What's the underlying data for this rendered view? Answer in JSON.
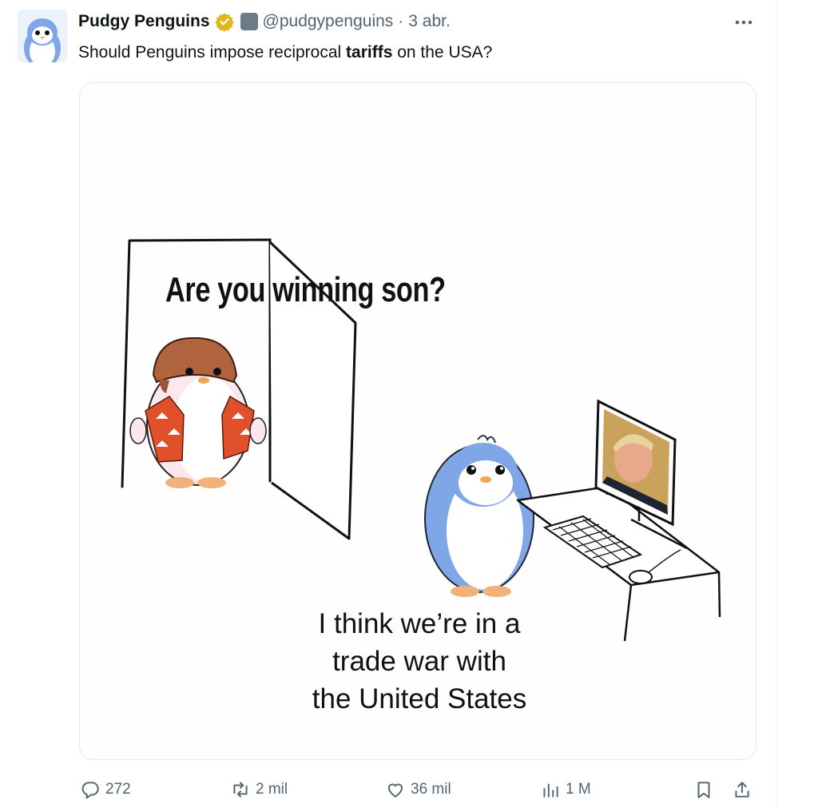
{
  "tweet": {
    "author": {
      "display_name": "Pudgy Penguins",
      "handle": "@pudgypenguins",
      "separator": "·",
      "time": "3 abr."
    },
    "text_before": "Should Penguins impose reciprocal ",
    "text_bold": "tariffs",
    "text_after": " on the USA?",
    "media": {
      "top_caption": "Are you winning son?",
      "bottom_caption_lines": [
        "I think we’re in a",
        "trade war with",
        "the United States"
      ]
    }
  },
  "actions": {
    "replies": "272",
    "reposts": "2 mil",
    "likes": "36 mil",
    "views": "1 M"
  },
  "icons": {
    "avatar": "penguin-avatar",
    "verified": "verified-badge-icon",
    "more": "more-options-icon",
    "reply": "reply-icon",
    "repost": "repost-icon",
    "like": "heart-icon",
    "views": "views-chart-icon",
    "bookmark": "bookmark-icon",
    "share": "share-icon"
  },
  "colors": {
    "text_secondary": "#536471",
    "verified_gold": "#e2b719",
    "border": "#e1e8ed"
  }
}
